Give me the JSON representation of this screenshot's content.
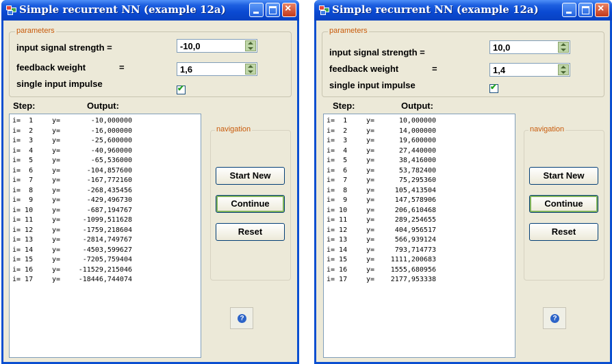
{
  "windows": [
    {
      "title": "Simple recurrent NN (example 12a)",
      "parameters": {
        "legend": "parameters",
        "input_signal_label": "input signal strength =",
        "input_signal_value": "-10,0",
        "feedback_label": "feedback weight",
        "feedback_eq": "=",
        "feedback_value": "1,6",
        "single_impulse_label": "single input impulse",
        "single_impulse_checked": true
      },
      "list_headers": {
        "step": "Step:",
        "output": "Output:"
      },
      "rows": [
        {
          "i": "i=  1",
          "y": "y=",
          "v": "-10,000000"
        },
        {
          "i": "i=  2",
          "y": "y=",
          "v": "-16,000000"
        },
        {
          "i": "i=  3",
          "y": "y=",
          "v": "-25,600000"
        },
        {
          "i": "i=  4",
          "y": "y=",
          "v": "-40,960000"
        },
        {
          "i": "i=  5",
          "y": "y=",
          "v": "-65,536000"
        },
        {
          "i": "i=  6",
          "y": "y=",
          "v": "-104,857600"
        },
        {
          "i": "i=  7",
          "y": "y=",
          "v": "-167,772160"
        },
        {
          "i": "i=  8",
          "y": "y=",
          "v": "-268,435456"
        },
        {
          "i": "i=  9",
          "y": "y=",
          "v": "-429,496730"
        },
        {
          "i": "i= 10",
          "y": "y=",
          "v": "-687,194767"
        },
        {
          "i": "i= 11",
          "y": "y=",
          "v": "-1099,511628"
        },
        {
          "i": "i= 12",
          "y": "y=",
          "v": "-1759,218604"
        },
        {
          "i": "i= 13",
          "y": "y=",
          "v": "-2814,749767"
        },
        {
          "i": "i= 14",
          "y": "y=",
          "v": "-4503,599627"
        },
        {
          "i": "i= 15",
          "y": "y=",
          "v": "-7205,759404"
        },
        {
          "i": "i= 16",
          "y": "y=",
          "v": "-11529,215046"
        },
        {
          "i": "i= 17",
          "y": "y=",
          "v": "-18446,744074"
        }
      ],
      "navigation": {
        "legend": "navigation",
        "start_new": "Start New",
        "continue": "Continue",
        "reset": "Reset"
      },
      "help_glyph": "?"
    },
    {
      "title": "Simple recurrent NN (example 12a)",
      "parameters": {
        "legend": "parameters",
        "input_signal_label": "input signal strength =",
        "input_signal_value": "10,0",
        "feedback_label": "feedback weight",
        "feedback_eq": "=",
        "feedback_value": "1,4",
        "single_impulse_label": "single input impulse",
        "single_impulse_checked": true
      },
      "list_headers": {
        "step": "Step:",
        "output": "Output:"
      },
      "rows": [
        {
          "i": "i=  1",
          "y": "y=",
          "v": "10,000000"
        },
        {
          "i": "i=  2",
          "y": "y=",
          "v": "14,000000"
        },
        {
          "i": "i=  3",
          "y": "y=",
          "v": "19,600000"
        },
        {
          "i": "i=  4",
          "y": "y=",
          "v": "27,440000"
        },
        {
          "i": "i=  5",
          "y": "y=",
          "v": "38,416000"
        },
        {
          "i": "i=  6",
          "y": "y=",
          "v": "53,782400"
        },
        {
          "i": "i=  7",
          "y": "y=",
          "v": "75,295360"
        },
        {
          "i": "i=  8",
          "y": "y=",
          "v": "105,413504"
        },
        {
          "i": "i=  9",
          "y": "y=",
          "v": "147,578906"
        },
        {
          "i": "i= 10",
          "y": "y=",
          "v": "206,610468"
        },
        {
          "i": "i= 11",
          "y": "y=",
          "v": "289,254655"
        },
        {
          "i": "i= 12",
          "y": "y=",
          "v": "404,956517"
        },
        {
          "i": "i= 13",
          "y": "y=",
          "v": "566,939124"
        },
        {
          "i": "i= 14",
          "y": "y=",
          "v": "793,714773"
        },
        {
          "i": "i= 15",
          "y": "y=",
          "v": "1111,200683"
        },
        {
          "i": "i= 16",
          "y": "y=",
          "v": "1555,680956"
        },
        {
          "i": "i= 17",
          "y": "y=",
          "v": "2177,953338"
        }
      ],
      "navigation": {
        "legend": "navigation",
        "start_new": "Start New",
        "continue": "Continue",
        "reset": "Reset"
      },
      "help_glyph": "?"
    }
  ],
  "colors": {
    "title_blue": "#0a49d1",
    "legend_orange": "#c85a0a",
    "check_green": "#21a121"
  }
}
